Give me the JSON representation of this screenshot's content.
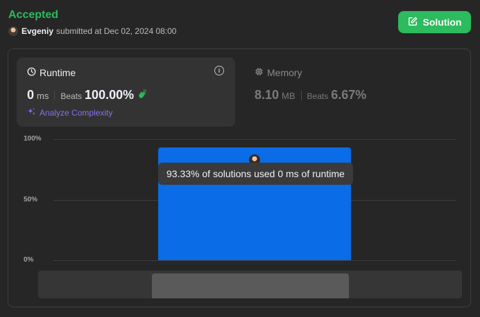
{
  "submission": {
    "status": "Accepted",
    "author": "Evgeniy",
    "submitted_text": "submitted at Dec 02, 2024 08:00"
  },
  "solution_button": {
    "label": "Solution"
  },
  "runtime": {
    "title": "Runtime",
    "value": "0",
    "unit": "ms",
    "beats_label": "Beats",
    "beats_value": "100.00%",
    "analyze_label": "Analyze Complexity"
  },
  "memory": {
    "title": "Memory",
    "value": "8.10",
    "unit": "MB",
    "beats_label": "Beats",
    "beats_value": "6.67%"
  },
  "chart_data": {
    "type": "bar",
    "categories": [
      "0 ms"
    ],
    "values": [
      93.33
    ],
    "ylim": [
      0,
      100
    ],
    "ytick_labels": [
      "100%",
      "50%",
      "0%"
    ],
    "ytick_values": [
      100,
      50,
      0
    ],
    "tooltip": "93.33% of solutions used 0 ms of runtime",
    "grid": true
  },
  "colors": {
    "accent_green": "#2cbb5d",
    "bar_blue": "#0a6ce6",
    "analyze_purple": "#8c6ff0"
  },
  "icons": {
    "solution": "edit-icon",
    "runtime": "clock-icon",
    "memory": "chip-icon",
    "info": "info-icon",
    "analyze": "sparkle-icon",
    "beats": "clap-icon"
  }
}
